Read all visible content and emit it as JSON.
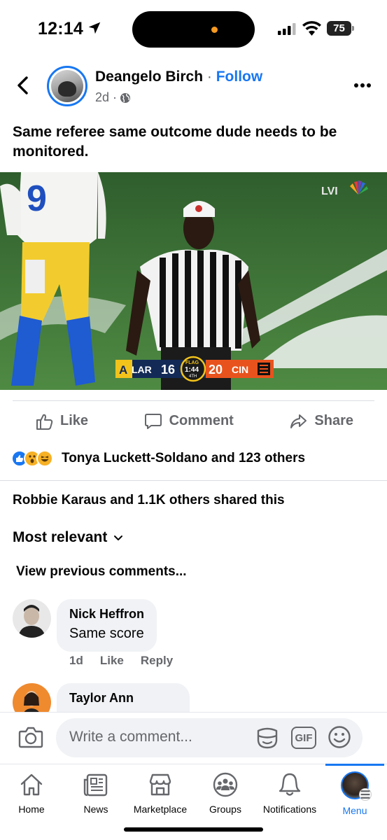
{
  "status_bar": {
    "time": "12:14",
    "battery": "75",
    "island_dot_color": "#f59a23"
  },
  "post": {
    "author": "Deangelo Birch",
    "separator": "·",
    "follow_label": "Follow",
    "time_ago": "2d ·",
    "text": "Same referee same outcome dude needs to be monitored.",
    "image": {
      "network_logo_text": "LVI",
      "scorebug": {
        "away_team": "LAR",
        "away_score": "16",
        "flag_label": "FLAG",
        "clock": "1:44",
        "quarter": "4TH",
        "home_score": "20",
        "home_team": "CIN"
      },
      "jersey_number": "9"
    }
  },
  "actions": {
    "like": "Like",
    "comment": "Comment",
    "share": "Share"
  },
  "reactions": {
    "text": "Tonya Luckett-Soldano and 123 others",
    "types": [
      "like-icon",
      "wow-icon",
      "haha-icon"
    ]
  },
  "shares": {
    "text": "Robbie Karaus and 1.1K others shared this"
  },
  "comments_section": {
    "sort_label": "Most relevant",
    "view_previous": "View previous comments...",
    "comments": [
      {
        "name": "Nick Heffron",
        "text": "Same score",
        "time": "1d",
        "like": "Like",
        "reply": "Reply"
      },
      {
        "name": "Taylor Ann"
      }
    ]
  },
  "composer": {
    "placeholder": "Write a comment...",
    "gif_label": "GIF"
  },
  "nav": {
    "items": [
      {
        "label": "Home",
        "icon": "home-icon"
      },
      {
        "label": "News",
        "icon": "news-icon"
      },
      {
        "label": "Marketplace",
        "icon": "marketplace-icon"
      },
      {
        "label": "Groups",
        "icon": "groups-icon"
      },
      {
        "label": "Notifications",
        "icon": "bell-icon"
      },
      {
        "label": "Menu",
        "icon": "profile-avatar"
      }
    ],
    "active": "Menu",
    "accent": "#1877f2"
  }
}
